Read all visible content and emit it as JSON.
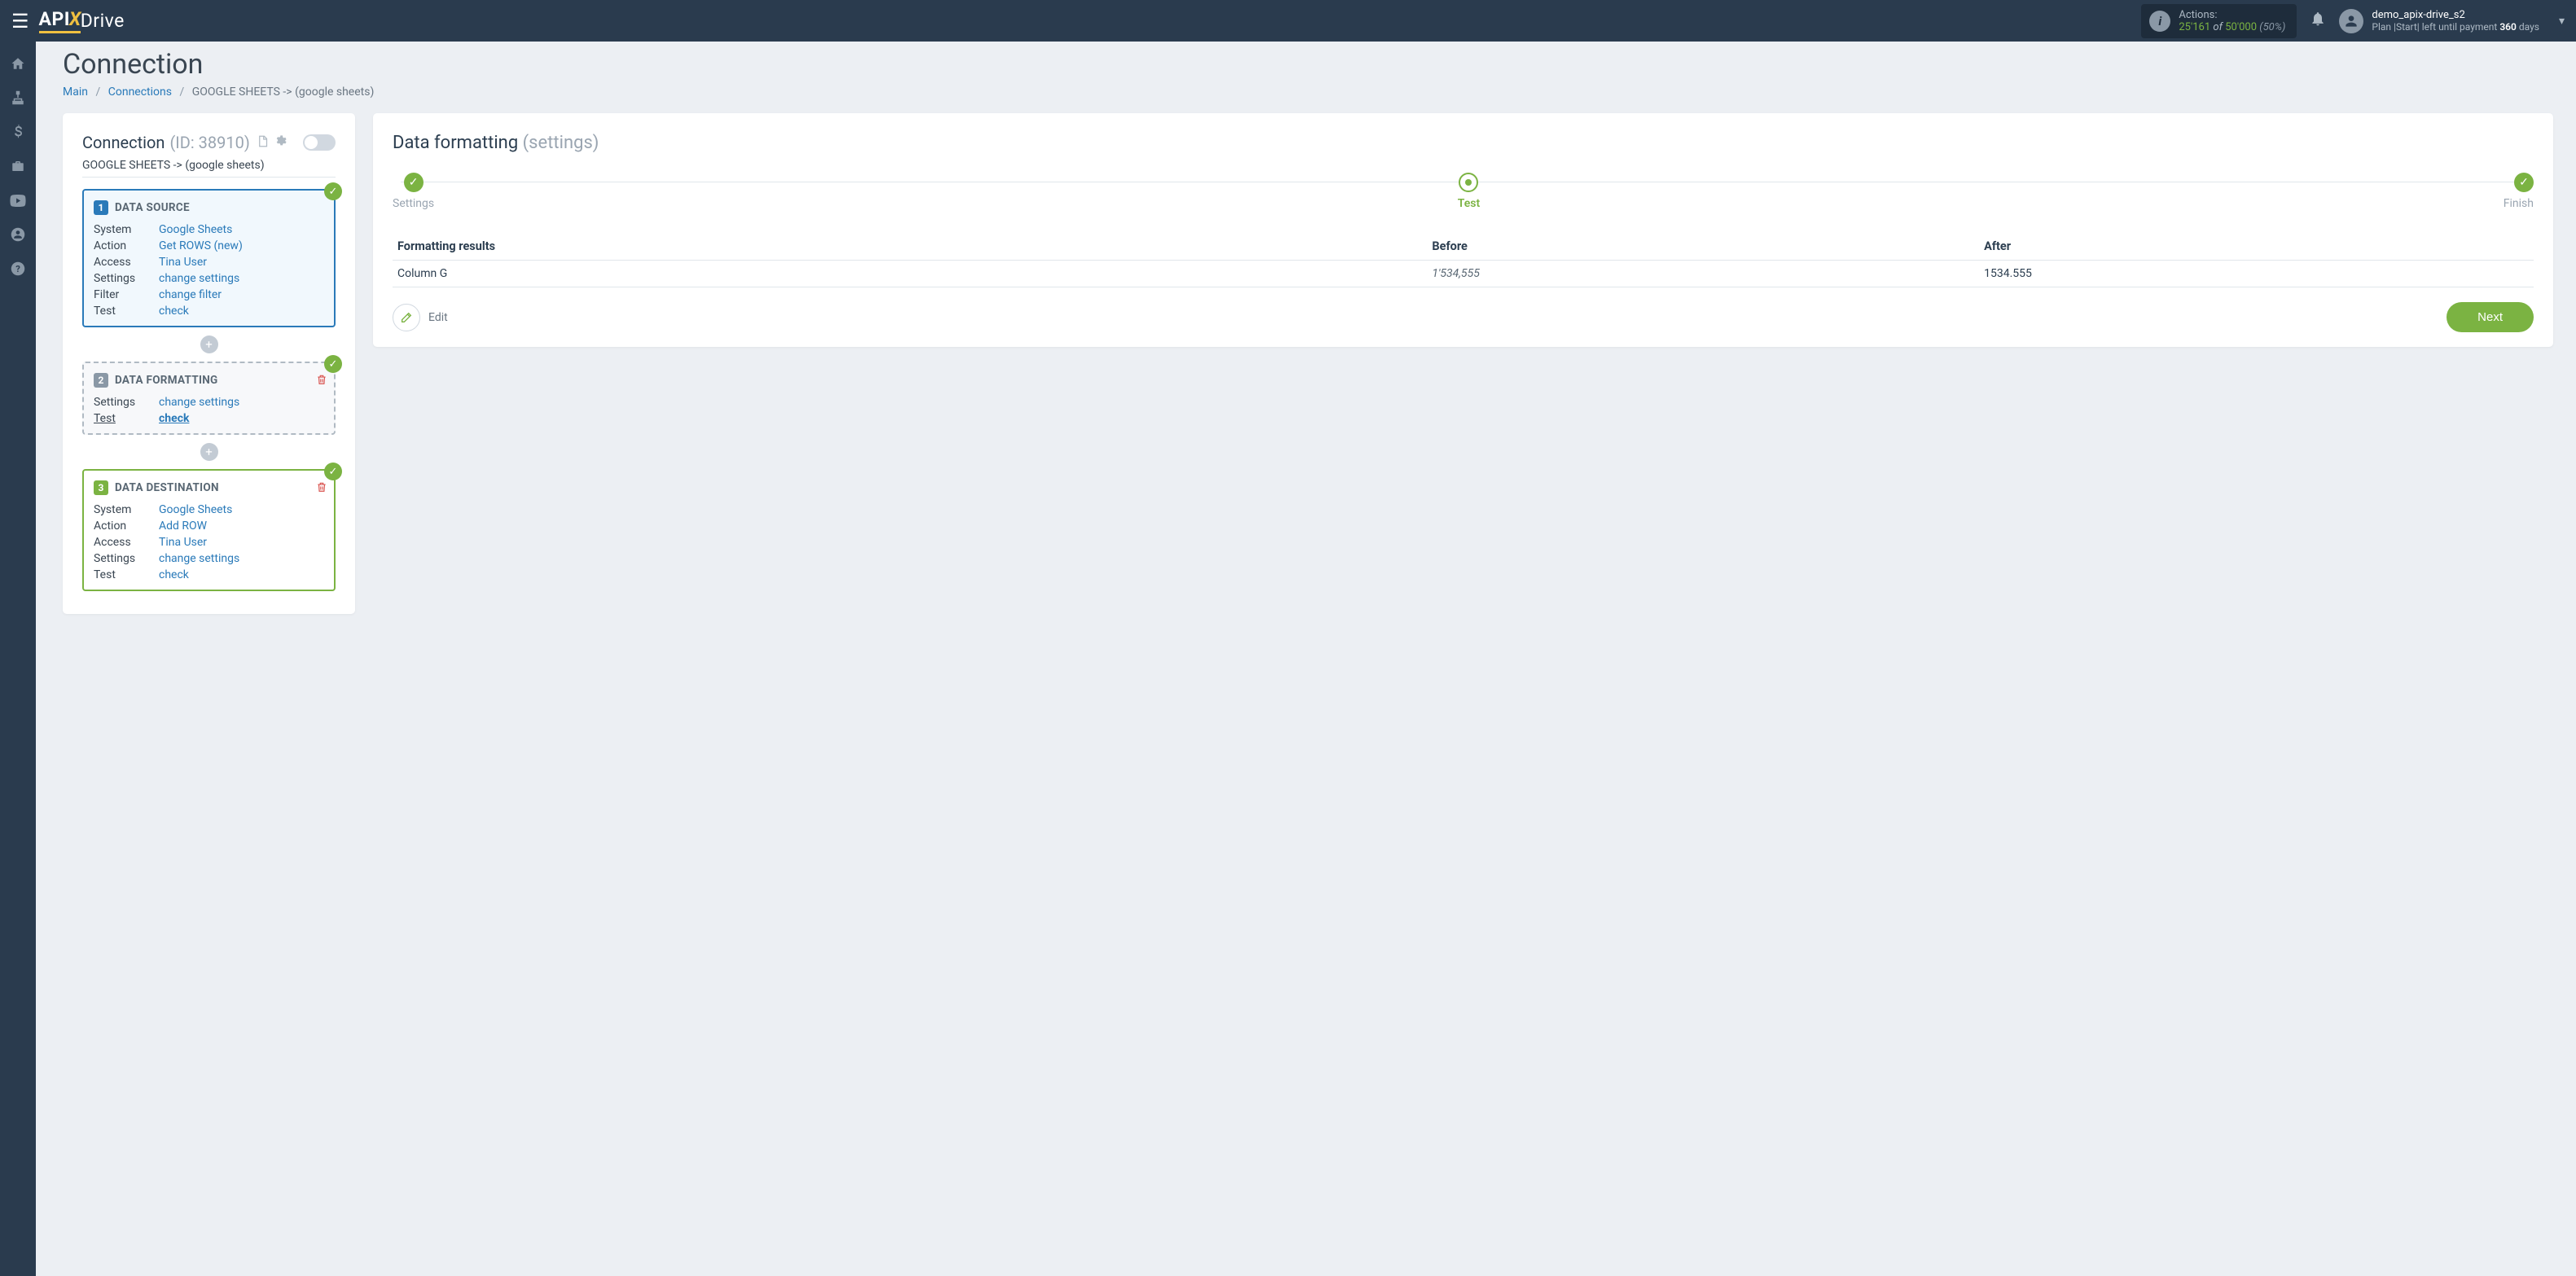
{
  "logo": {
    "part1": "API",
    "part2": "X",
    "part3": "Drive"
  },
  "header": {
    "actions_label": "Actions:",
    "actions_count": "25'161",
    "actions_of": "of",
    "actions_total": "50'000",
    "actions_pct": "(50%)",
    "user_name": "demo_apix-drive_s2",
    "plan_prefix": "Plan |Start| left until payment ",
    "plan_days": "360",
    "plan_suffix": " days"
  },
  "page": {
    "title": "Connection",
    "breadcrumb": {
      "main": "Main",
      "connections": "Connections",
      "current": "GOOGLE SHEETS -> (google sheets)"
    }
  },
  "connection": {
    "title": "Connection",
    "id": "(ID: 38910)",
    "name": "GOOGLE SHEETS -> (google sheets)"
  },
  "steps": {
    "source": {
      "num": "1",
      "title": "DATA SOURCE",
      "rows": [
        {
          "label": "System",
          "value": "Google Sheets"
        },
        {
          "label": "Action",
          "value": "Get ROWS (new)"
        },
        {
          "label": "Access",
          "value": "Tina User"
        },
        {
          "label": "Settings",
          "value": "change settings"
        },
        {
          "label": "Filter",
          "value": "change filter"
        },
        {
          "label": "Test",
          "value": "check"
        }
      ]
    },
    "formatting": {
      "num": "2",
      "title": "DATA FORMATTING",
      "rows": [
        {
          "label": "Settings",
          "value": "change settings"
        },
        {
          "label": "Test",
          "value": "check",
          "active": true
        }
      ]
    },
    "destination": {
      "num": "3",
      "title": "DATA DESTINATION",
      "rows": [
        {
          "label": "System",
          "value": "Google Sheets"
        },
        {
          "label": "Action",
          "value": "Add ROW"
        },
        {
          "label": "Access",
          "value": "Tina User"
        },
        {
          "label": "Settings",
          "value": "change settings"
        },
        {
          "label": "Test",
          "value": "check"
        }
      ]
    }
  },
  "right": {
    "title": "Data formatting",
    "subtitle": "(settings)",
    "stepper": {
      "settings": "Settings",
      "test": "Test",
      "finish": "Finish"
    },
    "table": {
      "headers": {
        "col1": "Formatting results",
        "col2": "Before",
        "col3": "After"
      },
      "rows": [
        {
          "name": "Column G",
          "before": "1'534,555",
          "after": "1534.555"
        }
      ]
    },
    "edit": "Edit",
    "next": "Next"
  }
}
